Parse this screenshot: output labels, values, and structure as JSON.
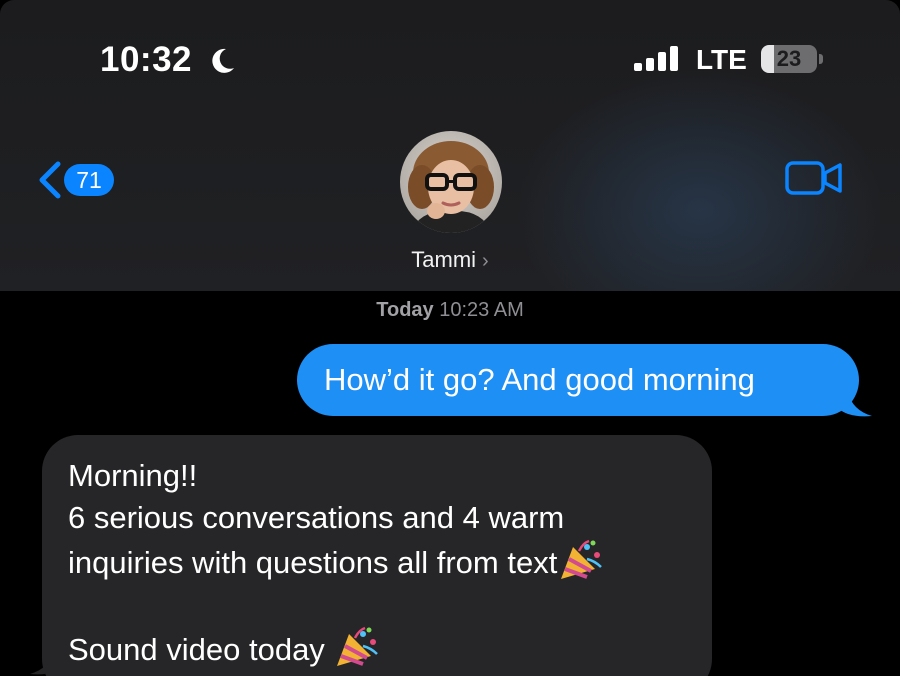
{
  "status_bar": {
    "time": "10:32",
    "focus_icon": "moon-icon",
    "signal_icon": "cellular-signal-icon",
    "network": "LTE",
    "battery_level": "23"
  },
  "nav": {
    "back_icon": "chevron-left-icon",
    "back_badge": "71",
    "contact_name": "Tammi",
    "contact_chevron": "›",
    "video_icon": "video-camera-icon"
  },
  "thread": {
    "timestamp_day": "Today",
    "timestamp_time": "10:23 AM",
    "messages": [
      {
        "direction": "outgoing",
        "text": "How’d it go? And good morning"
      },
      {
        "direction": "incoming",
        "line1": "Morning!!",
        "line2": "6 serious conversations and 4 warm",
        "line3": "inquiries with questions all from text",
        "line4": "Sound video today",
        "emoji": "party-popper-icon"
      }
    ]
  },
  "colors": {
    "outgoing_bubble": "#1e8ff5",
    "incoming_bubble": "#262628",
    "accent": "#0a84ff",
    "secondary_text": "#8e8e93"
  }
}
